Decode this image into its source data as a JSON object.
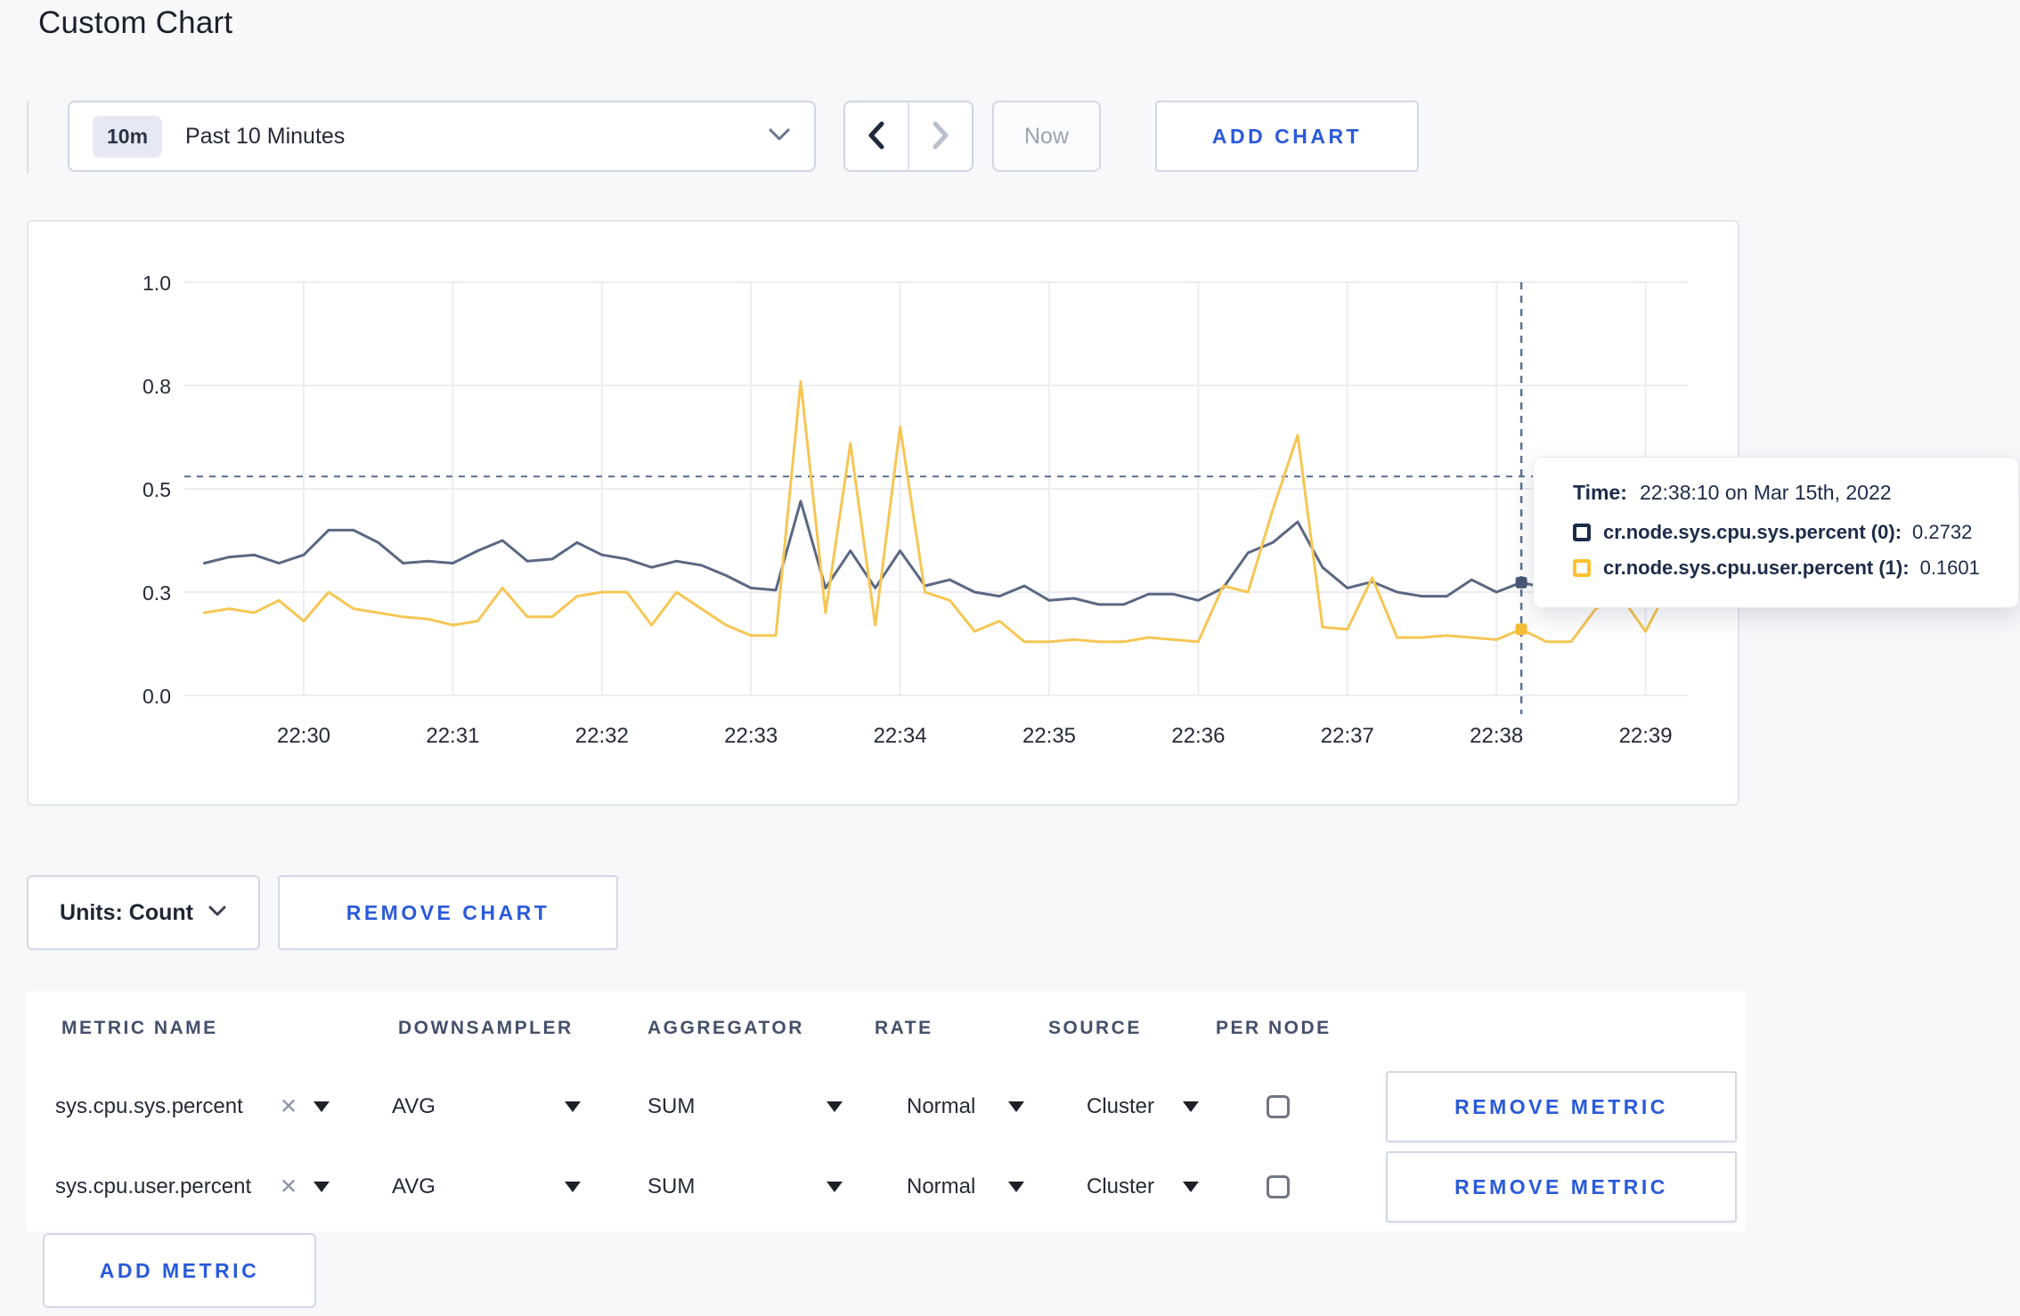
{
  "page": {
    "title": "Custom Chart"
  },
  "toolbar": {
    "range_badge": "10m",
    "range_label": "Past 10 Minutes",
    "prev_icon": "chevron-left",
    "next_icon": "chevron-right",
    "now_label": "Now",
    "add_chart_label": "ADD CHART"
  },
  "chart_data": {
    "type": "line",
    "title": "",
    "xlabel": "",
    "ylabel": "",
    "ylim": [
      0,
      1
    ],
    "x_start": "22:29:20",
    "x_step_seconds": 10,
    "x_tick_labels": [
      "22:30",
      "22:31",
      "22:32",
      "22:33",
      "22:34",
      "22:35",
      "22:36",
      "22:37",
      "22:38",
      "22:39"
    ],
    "y_tick_labels": [
      "0.0",
      "0.3",
      "0.5",
      "0.8",
      "1.0"
    ],
    "y_tick_values": [
      0,
      0.25,
      0.5,
      0.75,
      1.0
    ],
    "grid": true,
    "legend_position": "none",
    "series": [
      {
        "name": "cr.node.sys.cpu.sys.percent",
        "color": "#5A6882",
        "values": [
          0.32,
          0.335,
          0.34,
          0.32,
          0.34,
          0.4,
          0.4,
          0.37,
          0.32,
          0.325,
          0.32,
          0.35,
          0.375,
          0.325,
          0.33,
          0.37,
          0.34,
          0.33,
          0.31,
          0.325,
          0.315,
          0.29,
          0.26,
          0.255,
          0.47,
          0.26,
          0.35,
          0.26,
          0.35,
          0.265,
          0.28,
          0.25,
          0.24,
          0.265,
          0.23,
          0.235,
          0.22,
          0.22,
          0.245,
          0.245,
          0.23,
          0.26,
          0.345,
          0.37,
          0.42,
          0.31,
          0.26,
          0.275,
          0.25,
          0.24,
          0.24,
          0.28,
          0.25,
          0.2732,
          0.26,
          0.28,
          0.29,
          0.29,
          0.3,
          0.3
        ]
      },
      {
        "name": "cr.node.sys.cpu.user.percent",
        "color": "#F6C654",
        "values": [
          0.2,
          0.21,
          0.2,
          0.23,
          0.18,
          0.25,
          0.21,
          0.2,
          0.19,
          0.185,
          0.17,
          0.18,
          0.26,
          0.19,
          0.19,
          0.24,
          0.25,
          0.25,
          0.17,
          0.25,
          0.21,
          0.17,
          0.145,
          0.145,
          0.76,
          0.2,
          0.61,
          0.17,
          0.65,
          0.25,
          0.23,
          0.155,
          0.18,
          0.13,
          0.13,
          0.135,
          0.13,
          0.13,
          0.14,
          0.135,
          0.13,
          0.265,
          0.25,
          0.45,
          0.63,
          0.165,
          0.16,
          0.285,
          0.14,
          0.14,
          0.145,
          0.14,
          0.135,
          0.1601,
          0.13,
          0.13,
          0.21,
          0.24,
          0.155,
          0.27
        ]
      }
    ],
    "highlight_index": 53,
    "crosshair_time": "22:38:10",
    "crosshair_hline_value": 0.53,
    "marker_colors": [
      "#4A5875",
      "#F5BD37"
    ],
    "grid_color": "#ECEDF2",
    "crosshair_color": "#5A7190",
    "tick_text_color": "#242a35"
  },
  "chart_tooltip": {
    "time_label": "Time:",
    "time_value": "22:38:10 on Mar 15th, 2022",
    "rows": [
      {
        "name": "cr.node.sys.cpu.sys.percent (0):",
        "value": "0.2732",
        "square_color": "#1C2B4A"
      },
      {
        "name": "cr.node.sys.cpu.user.percent (1):",
        "value": "0.1601",
        "square_color": "#FFC12E"
      }
    ]
  },
  "units_bar": {
    "units_label": "Units: Count",
    "remove_chart_label": "REMOVE CHART"
  },
  "metrics_table": {
    "headers": [
      "METRIC NAME",
      "DOWNSAMPLER",
      "AGGREGATOR",
      "RATE",
      "SOURCE",
      "PER NODE"
    ],
    "rows": [
      {
        "name": "sys.cpu.sys.percent",
        "downsampler": "AVG",
        "aggregator": "SUM",
        "rate": "Normal",
        "source": "Cluster",
        "per_node_checked": false,
        "remove_label": "REMOVE METRIC"
      },
      {
        "name": "sys.cpu.user.percent",
        "downsampler": "AVG",
        "aggregator": "SUM",
        "rate": "Normal",
        "source": "Cluster",
        "per_node_checked": false,
        "remove_label": "REMOVE METRIC"
      }
    ],
    "add_metric_label": "ADD METRIC"
  }
}
